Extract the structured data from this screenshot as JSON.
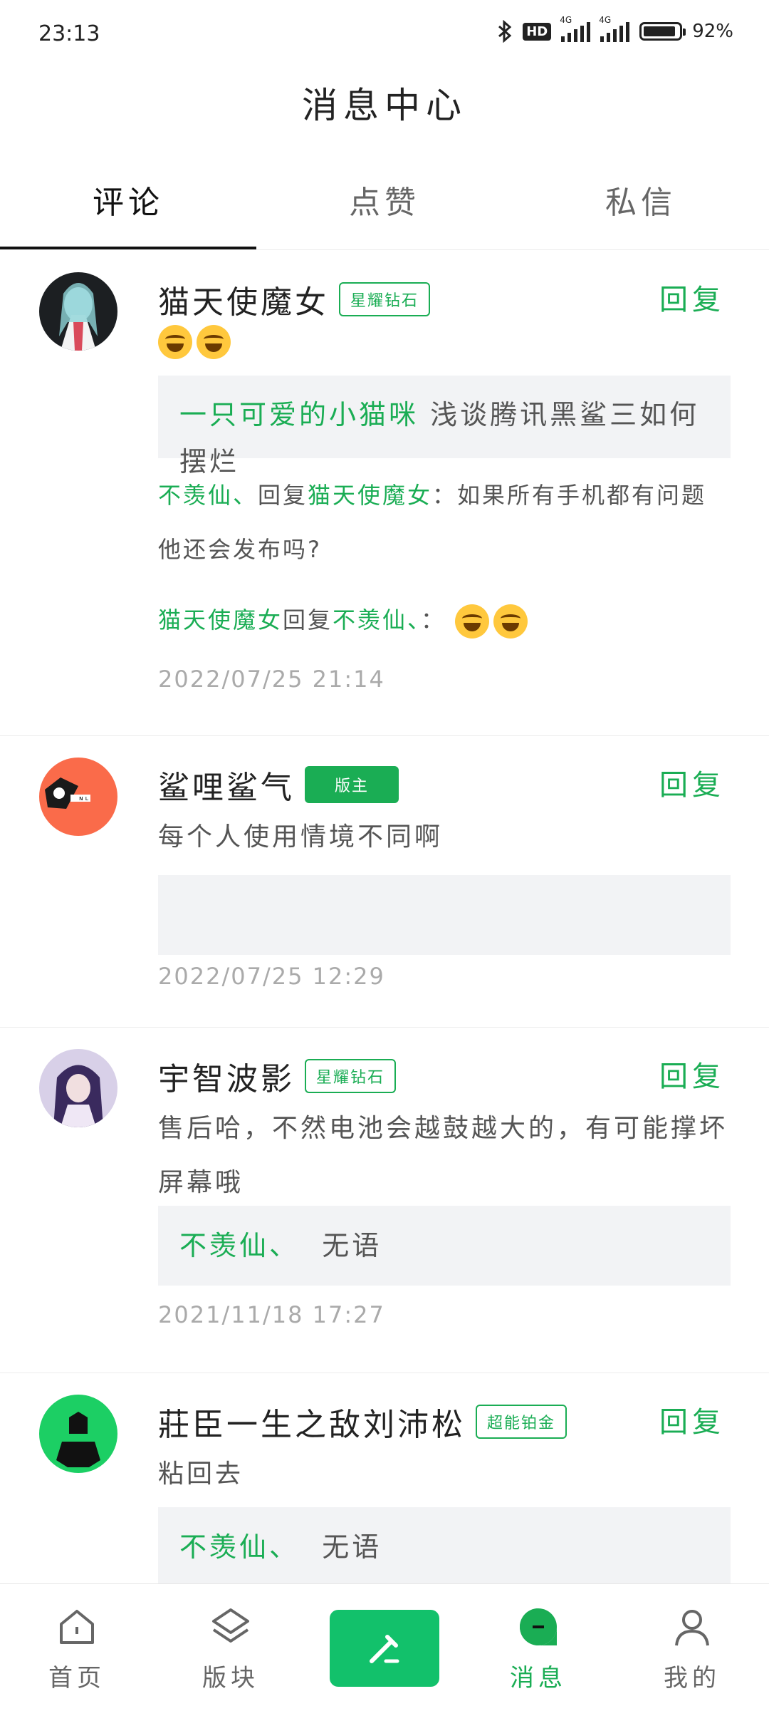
{
  "status": {
    "time": "23:13",
    "battery": "92%",
    "battery_level": 0.92,
    "network": "4G",
    "hd": "HD"
  },
  "header": {
    "title": "消息中心"
  },
  "tabs": [
    {
      "label": "评论",
      "active": true
    },
    {
      "label": "点赞",
      "active": false
    },
    {
      "label": "私信",
      "active": false
    }
  ],
  "reply_label": "回复",
  "cards": [
    {
      "name": "猫天使魔女",
      "badge": "星耀钻石",
      "quote_user": "一只可爱的小猫咪",
      "quote_text": "浅谈腾讯黑鲨三如何摆烂",
      "sub1_user": "不羡仙、",
      "sub1_mid": "回复",
      "sub1_target": "猫天使魔女",
      "sub1_text": "：如果所有手机都有问题他还会发布吗?",
      "sub2_user": "猫天使魔女",
      "sub2_mid": "回复",
      "sub2_target": "不羡仙、",
      "sub2_text": "：",
      "time": "2022/07/25 21:14"
    },
    {
      "name": "鲨哩鲨气",
      "badge": "版主",
      "text": "每个人使用情境不同啊",
      "time": "2022/07/25 12:29"
    },
    {
      "name": "宇智波影",
      "badge": "星耀钻石",
      "text": "售后哈，不然电池会越鼓越大的，有可能撑坏屏幕哦",
      "quote_user": "不羡仙、",
      "quote_text": "无语",
      "time": "2021/11/18 17:27"
    },
    {
      "name": "莊臣一生之敌刘沛松",
      "badge": "超能铂金",
      "text": "粘回去",
      "quote_user": "不羡仙、",
      "quote_text": "无语"
    }
  ],
  "bottom_nav": [
    {
      "label": "首页",
      "icon": "home-icon"
    },
    {
      "label": "版块",
      "icon": "layers-icon"
    },
    {
      "label": "",
      "icon": "compose-icon"
    },
    {
      "label": "消息",
      "icon": "message-icon",
      "active": true
    },
    {
      "label": "我的",
      "icon": "profile-icon"
    }
  ],
  "colors": {
    "accent": "#1aad54",
    "compose_bg": "#12c16b",
    "quote_bg": "#f2f3f5"
  }
}
